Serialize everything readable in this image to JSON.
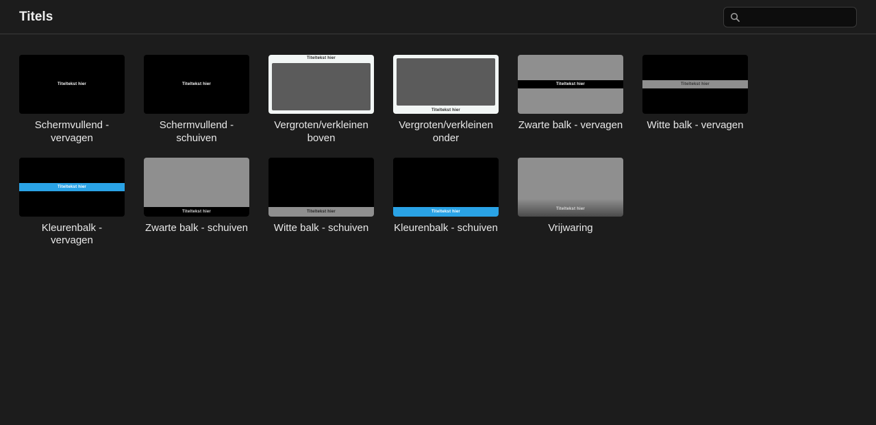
{
  "header": {
    "title": "Titels",
    "search_placeholder": ""
  },
  "placeholder_label": "Titeltekst hier",
  "items": [
    {
      "id": "fullscreen-fade",
      "label": "Schermvullend - vervagen",
      "thumb": "t-full-fade"
    },
    {
      "id": "fullscreen-slide",
      "label": "Schermvullend - schuiven",
      "thumb": "t-full-slide"
    },
    {
      "id": "scale-top",
      "label": "Vergroten/verkleinen boven",
      "thumb": "t-scale-top"
    },
    {
      "id": "scale-bottom",
      "label": "Vergroten/verkleinen onder",
      "thumb": "t-scale-bottom"
    },
    {
      "id": "blackbar-fade",
      "label": "Zwarte balk - vervagen",
      "thumb": "t-blackbar-fade"
    },
    {
      "id": "whitebar-fade",
      "label": "Witte balk - vervagen",
      "thumb": "t-whitebar-fade"
    },
    {
      "id": "colorbar-fade",
      "label": "Kleurenbalk - vervagen",
      "thumb": "t-colorbar-fade"
    },
    {
      "id": "blackbar-slide",
      "label": "Zwarte balk - schuiven",
      "thumb": "t-blackbar-slide"
    },
    {
      "id": "whitebar-slide",
      "label": "Witte balk - schuiven",
      "thumb": "t-whitebar-slide"
    },
    {
      "id": "colorbar-slide",
      "label": "Kleurenbalk - schuiven",
      "thumb": "t-colorbar-slide"
    },
    {
      "id": "disclaimer",
      "label": "Vrijwaring",
      "thumb": "t-disclaimer"
    }
  ]
}
